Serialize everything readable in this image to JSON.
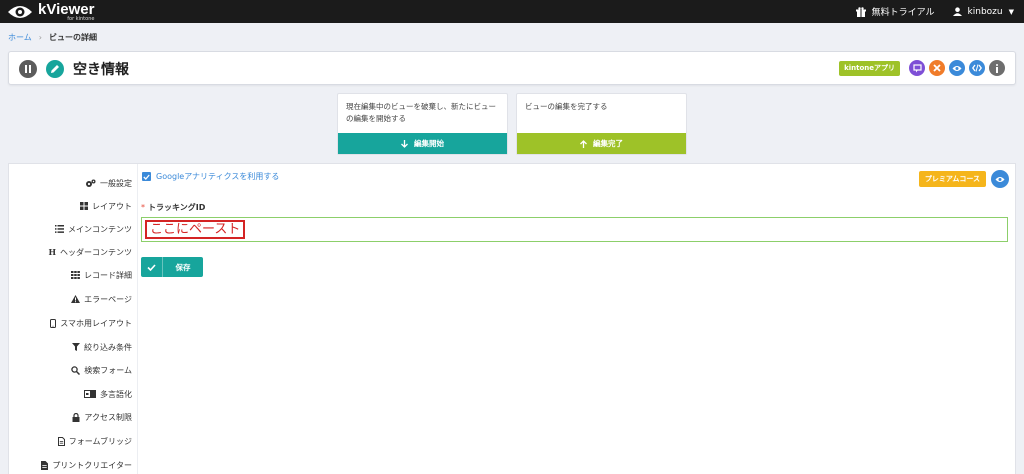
{
  "app": {
    "name": "kViewer",
    "subname": "for kintone"
  },
  "topbar": {
    "trial": "無料トライアル",
    "user": "kinbozu"
  },
  "breadcrumb": {
    "home": "ホーム",
    "separator": "›",
    "current": "ビューの詳細"
  },
  "header": {
    "title": "空き情報",
    "kintone_label": "kintoneアプリ"
  },
  "edit_boxes": [
    {
      "text": "現在編集中のビューを破棄し、新たにビューの編集を開始する",
      "button": "編集開始",
      "color": "#17a59c"
    },
    {
      "text": "ビューの編集を完了する",
      "button": "編集完了",
      "color": "#9ec228"
    }
  ],
  "side_menu": [
    {
      "label": "一般設定",
      "icon": "gears-icon"
    },
    {
      "label": "レイアウト",
      "icon": "grid-icon"
    },
    {
      "label": "メインコンテンツ",
      "icon": "list-icon"
    },
    {
      "label": "ヘッダーコンテンツ",
      "icon": "heading-icon"
    },
    {
      "label": "レコード詳細",
      "icon": "table-icon"
    },
    {
      "label": "エラーページ",
      "icon": "warning-icon"
    },
    {
      "label": "スマホ用レイアウト",
      "icon": "mobile-icon"
    },
    {
      "label": "絞り込み条件",
      "icon": "filter-icon"
    },
    {
      "label": "検索フォーム",
      "icon": "search-icon"
    },
    {
      "label": "多言語化",
      "icon": "language-icon"
    },
    {
      "label": "アクセス制限",
      "icon": "lock-icon"
    },
    {
      "label": "フォームブリッジ",
      "icon": "file-icon"
    },
    {
      "label": "プリントクリエイター",
      "icon": "document-icon"
    }
  ],
  "content": {
    "ga_checkbox_label": "Googleアナリティクスを利用する",
    "ga_checked": true,
    "premium_label": "プレミアムコース",
    "tracking_label": "トラッキングID",
    "required_mark": "*",
    "tracking_value": "",
    "paste_hint": "ここにペースト",
    "save_label": "保存"
  },
  "colors": {
    "teal": "#17a59c",
    "green": "#9ec228",
    "blue": "#3b8ad9",
    "orange": "#f5b51b",
    "red": "#d42424",
    "purple": "#7e4fd6",
    "dark": "#1b1b1b"
  }
}
